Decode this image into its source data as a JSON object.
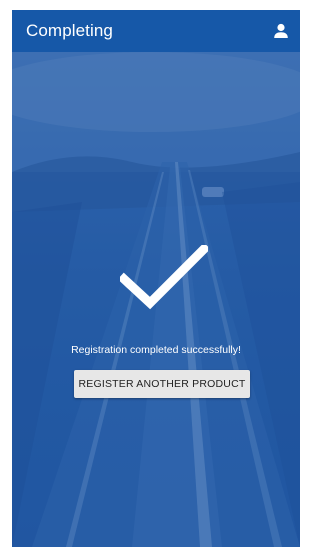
{
  "app_bar": {
    "title": "Completing",
    "account_icon": "account-icon",
    "background_color": "#1658a8"
  },
  "status": {
    "icon": "check-icon",
    "message": "Registration completed successfully!"
  },
  "actions": {
    "register_another_label": "REGISTER ANOTHER PRODUCT"
  },
  "background": {
    "description_icon": "highway-background",
    "tint_color": "#2a64ab"
  }
}
